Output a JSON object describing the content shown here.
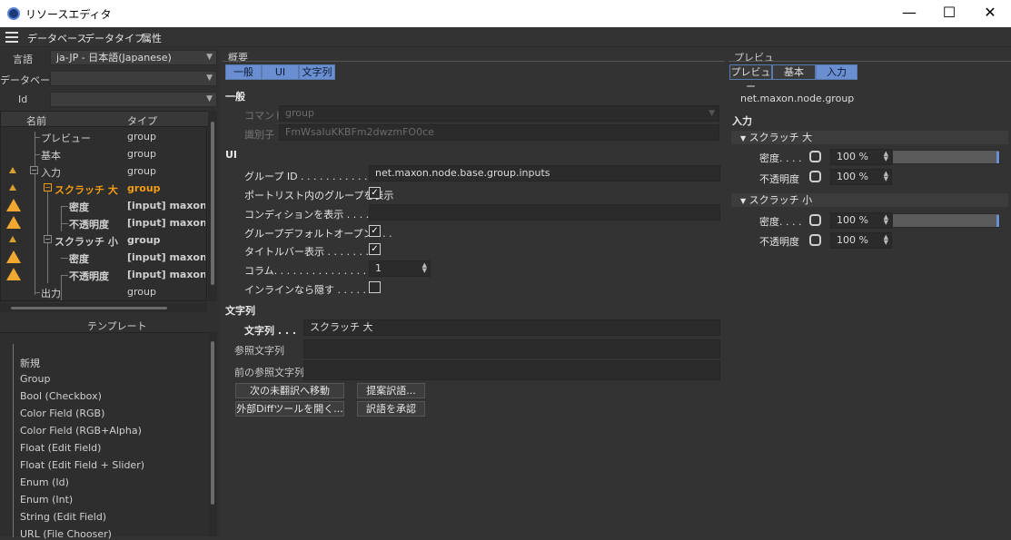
{
  "window": {
    "title": "リソースエディタ",
    "minimize": "—",
    "maximize": "☐",
    "close": "✕"
  },
  "menu": {
    "items": [
      "データベース",
      "データタイプ",
      "属性"
    ]
  },
  "left": {
    "language_label": "言語",
    "language_value": "ja-JP - 日本語(Japanese)",
    "database_label": "データベース",
    "database_value": "",
    "id_label": "Id",
    "id_value": "",
    "col_name": "名前",
    "col_type": "タイプ",
    "tree": [
      {
        "name": "プレビュー",
        "type": "group"
      },
      {
        "name": "基本",
        "type": "group"
      },
      {
        "name": "入力",
        "type": "group"
      },
      {
        "name": "スクラッチ 大",
        "type": "group"
      },
      {
        "name": "密度",
        "type": "[input] maxon::Fl"
      },
      {
        "name": "不透明度",
        "type": "[input] maxon::Fl"
      },
      {
        "name": "スクラッチ 小",
        "type": "group"
      },
      {
        "name": "密度",
        "type": "[input] maxon::Fl"
      },
      {
        "name": "不透明度",
        "type": "[input] maxon::Fl"
      },
      {
        "name": "出力",
        "type": "group"
      }
    ],
    "template_title": "テンプレート",
    "templates": [
      "新規",
      "Group",
      "Bool (Checkbox)",
      "Color Field (RGB)",
      "Color Field (RGB+Alpha)",
      "Float (Edit Field)",
      "Float (Edit Field + Slider)",
      "Enum (Id)",
      "Enum (Int)",
      "String (Edit Field)",
      "URL (File Chooser)"
    ]
  },
  "mid": {
    "panel_title": "概要",
    "tabs": [
      "一般",
      "UI",
      "文字列"
    ],
    "sec_general": "一般",
    "command_label": "コマンド",
    "command_value": "group",
    "ident_label": "識別子",
    "ident_value": "FmWsaIuKKBFm2dwzmFO0ce",
    "sec_ui": "UI",
    "group_id_label": "グループ ID . . . . . . . . . . . .",
    "group_id_value": "net.maxon.node.base.group.inputs",
    "show_in_port_label": "ポートリスト内のグループを表示",
    "condition_label": "コンディションを表示 . . . . . .",
    "condition_value": "",
    "default_open_label": "グループデフォルトオープン . . .",
    "titlebar_label": "タイトルバー表示 . . . . . . . .",
    "columns_label": "コラム. . . . . . . . . . . . . . . .",
    "columns_value": "1",
    "hide_inline_label": "インラインなら隠す . . . . . . .",
    "sec_string": "文字列",
    "string_label": "文字列 . . .",
    "string_value": "スクラッチ 大",
    "ref_label": "参照文字列",
    "ref_value": "",
    "prev_ref_label": "前の参照文字列",
    "prev_ref_value": "",
    "btn_next": "次の未翻訳へ移動",
    "btn_suggest": "提案訳語...",
    "btn_diff": "外部Diffツールを開く...",
    "btn_approve": "訳語を承認",
    "check": "✓"
  },
  "right": {
    "panel_title": "プレビュ",
    "tabs": [
      "プレビュー",
      "基本",
      "入力"
    ],
    "node_path": "net.maxon.node.group",
    "input_title": "入力",
    "groups": [
      {
        "title": "スクラッチ 大",
        "rows": [
          {
            "label": "密度. . . .",
            "value": "100 %",
            "level": 1.0
          },
          {
            "label": "不透明度",
            "value": "100 %"
          }
        ]
      },
      {
        "title": "スクラッチ 小",
        "rows": [
          {
            "label": "密度. . . .",
            "value": "100 %",
            "level": 1.0
          },
          {
            "label": "不透明度",
            "value": "100 %"
          }
        ]
      }
    ]
  }
}
